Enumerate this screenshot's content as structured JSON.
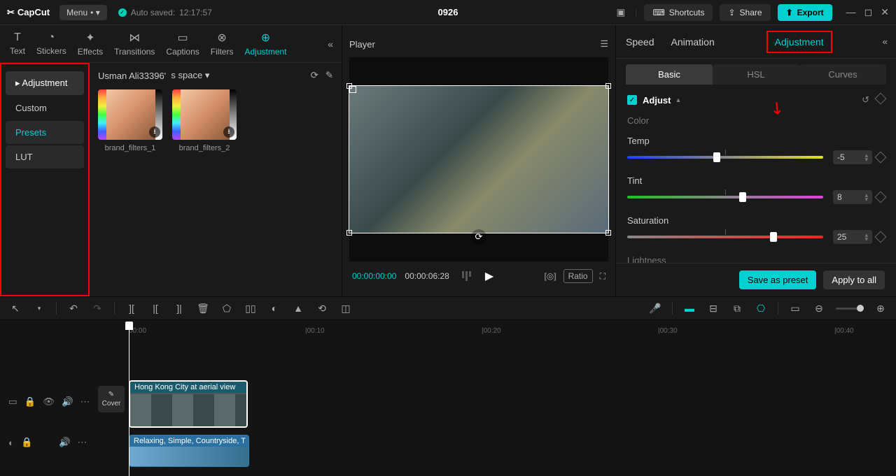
{
  "titlebar": {
    "logo": "CapCut",
    "menu": "Menu",
    "autosave_label": "Auto saved:",
    "autosave_time": "12:17:57",
    "project": "0926",
    "shortcuts": "Shortcuts",
    "share": "Share",
    "export": "Export"
  },
  "media_tabs": [
    {
      "label": "Text"
    },
    {
      "label": "Stickers"
    },
    {
      "label": "Effects"
    },
    {
      "label": "Transitions"
    },
    {
      "label": "Captions"
    },
    {
      "label": "Filters"
    },
    {
      "label": "Adjustment"
    }
  ],
  "sidebar": {
    "items": [
      {
        "label": "Adjustment"
      },
      {
        "label": "Custom"
      },
      {
        "label": "Presets"
      },
      {
        "label": "LUT"
      }
    ]
  },
  "media_header": {
    "user": "Usman Ali33396'",
    "space": "s space"
  },
  "thumbs": [
    {
      "label": "brand_filters_1"
    },
    {
      "label": "brand_filters_2"
    }
  ],
  "player": {
    "title": "Player",
    "time_current": "00:00:00:00",
    "time_total": "00:00:06:28",
    "ratio": "Ratio"
  },
  "inspector": {
    "tabs": [
      "Speed",
      "Animation",
      "Adjustment"
    ],
    "subtabs": [
      "Basic",
      "HSL",
      "Curves"
    ],
    "adjust_title": "Adjust",
    "color_label": "Color",
    "lightness_label": "Lightness",
    "sliders": {
      "temp": {
        "label": "Temp",
        "value": "-5",
        "pos": 44
      },
      "tint": {
        "label": "Tint",
        "value": "8",
        "pos": 57
      },
      "saturation": {
        "label": "Saturation",
        "value": "25",
        "pos": 73
      }
    },
    "save_preset": "Save as preset",
    "apply_all": "Apply to all"
  },
  "timeline": {
    "ticks": [
      "00:00",
      "|00:10",
      "|00:20",
      "|00:30",
      "|00:40"
    ],
    "cover": "Cover",
    "video_clip": "Hong Kong City at  aerial view",
    "audio_clip": "Relaxing, Simple, Countryside, T"
  }
}
